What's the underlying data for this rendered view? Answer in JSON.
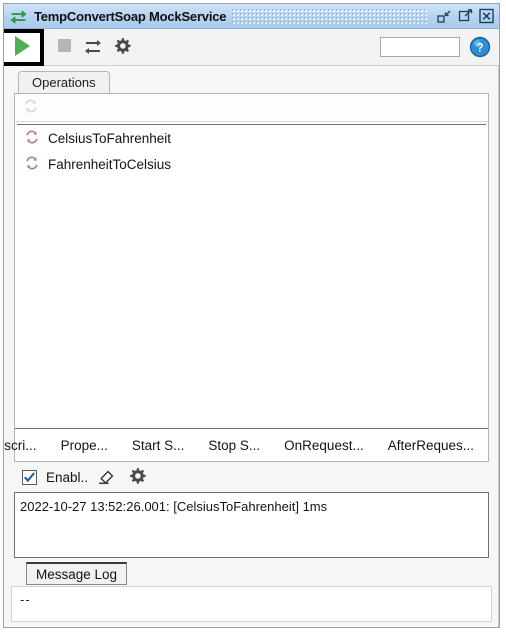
{
  "window": {
    "title": "TempConvertSoap MockService",
    "icon": "exchange-arrows-icon",
    "buttons": {
      "minimize_label": "",
      "restore_label": "",
      "close_label": ""
    }
  },
  "toolbar": {
    "run_icon": "play-icon",
    "stop_icon": "stop-icon",
    "options_icon": "sliders-icon",
    "settings_icon": "gear-icon",
    "field_value": "",
    "field_placeholder": "",
    "help_icon": "help-icon"
  },
  "tabs": {
    "operations_label": "Operations"
  },
  "operations_panel": {
    "list_toolbar_icon": "refresh-operation-icon",
    "items": [
      {
        "icon": "operation-icon",
        "label": "CelsiusToFahrenheit"
      },
      {
        "icon": "operation-icon",
        "label": "FahrenheitToCelsius"
      }
    ],
    "buttons": [
      {
        "label": "Descri..."
      },
      {
        "label": "Prope..."
      },
      {
        "label": "Start S..."
      },
      {
        "label": "Stop S..."
      },
      {
        "label": "OnRequest..."
      },
      {
        "label": "AfterReques..."
      }
    ]
  },
  "log_controls": {
    "enabled_label": "Enabl..",
    "enabled_checked": true,
    "check_glyph": "✓",
    "clear_icon": "eraser-icon",
    "settings_icon": "gear-icon"
  },
  "message_log": {
    "lines": [
      "2022-10-27 13:52:26.001: [CelsiusToFahrenheit] 1ms"
    ],
    "tab_label": "Message Log"
  },
  "status_bar": {
    "text": "--"
  },
  "colors": {
    "titlebar": "#b7d4f0",
    "play_green": "#3faa4a",
    "accent_blue": "#1e7fd4",
    "operation_icon": "#b08c7a"
  }
}
